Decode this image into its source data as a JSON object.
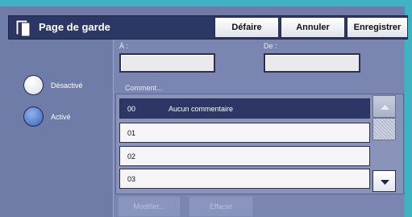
{
  "header": {
    "title": "Page de garde",
    "buttons": {
      "undo": "Défaire",
      "cancel": "Annuler",
      "save": "Enregistrer"
    }
  },
  "radios": {
    "off_label": "Désactivé",
    "on_label": "Activé",
    "selected": "on"
  },
  "fields": {
    "to_label": "À :",
    "to_value": "",
    "from_label": "De :",
    "from_value": ""
  },
  "comments": {
    "label": "Comment...",
    "rows": [
      {
        "num": "00",
        "text": "Aucun commentaire",
        "selected": true
      },
      {
        "num": "01",
        "text": ""
      },
      {
        "num": "02",
        "text": ""
      },
      {
        "num": "03",
        "text": ""
      }
    ]
  },
  "footer": {
    "modify": "Modifier...",
    "clear": "Effacer"
  },
  "colors": {
    "header": "#2d3766",
    "accent": "#3fb3c4",
    "panel": "#7a86b1",
    "selected_row": "#2d3766"
  }
}
